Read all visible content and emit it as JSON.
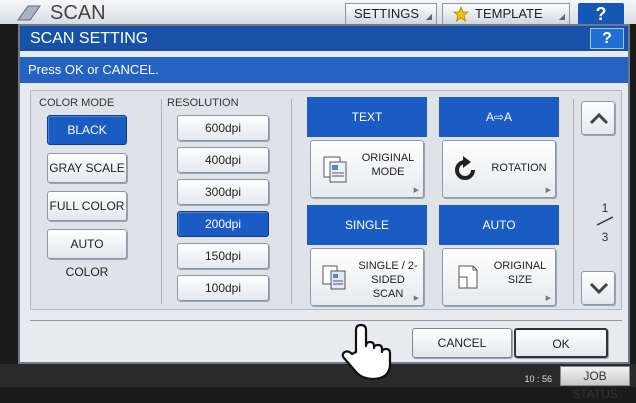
{
  "app": {
    "title": "SCAN",
    "tabs": [
      {
        "label": "SETTINGS"
      },
      {
        "label": "TEMPLATE"
      }
    ],
    "help_label": "?",
    "clock": "10 : 56",
    "job_status_label": "JOB STATUS"
  },
  "dialog": {
    "title": "SCAN SETTING",
    "help_label": "?",
    "message": "Press OK or CANCEL."
  },
  "color_mode": {
    "label": "COLOR MODE",
    "options": [
      "BLACK",
      "GRAY SCALE",
      "FULL COLOR",
      "AUTO COLOR"
    ],
    "selected": "BLACK"
  },
  "resolution": {
    "label": "RESOLUTION",
    "options": [
      "600dpi",
      "400dpi",
      "300dpi",
      "200dpi",
      "150dpi",
      "100dpi"
    ],
    "selected": "200dpi"
  },
  "functions": {
    "original_mode": {
      "header": "TEXT",
      "label": "ORIGINAL\nMODE",
      "icon": "document-mode-icon"
    },
    "rotation": {
      "header": "A⇨A",
      "label": "ROTATION",
      "icon": "rotate-icon"
    },
    "sided_scan": {
      "header": "SINGLE",
      "label": "SINGLE / 2-\nSIDED SCAN",
      "icon": "duplex-icon"
    },
    "original_size": {
      "header": "AUTO",
      "label": "ORIGINAL\nSIZE",
      "icon": "paper-size-icon"
    }
  },
  "pagination": {
    "current": "1",
    "total": "3"
  },
  "buttons": {
    "cancel": "CANCEL",
    "ok": "OK"
  },
  "colors": {
    "accent_blue": "#1a5cc4",
    "title_blue": "#1852a8"
  }
}
